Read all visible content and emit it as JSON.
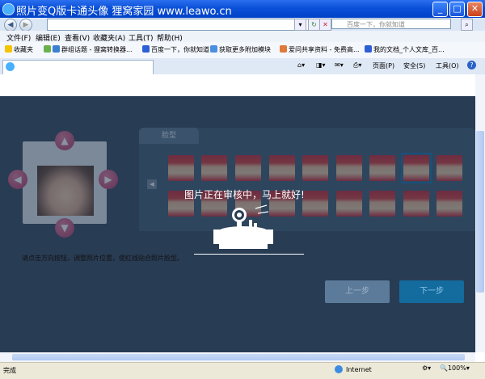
{
  "window": {
    "title": "照片变Q版卡通头像    狸窝家园  www.leawo.cn",
    "minimize": "_",
    "maximize": "□",
    "close": "✕"
  },
  "address_bar": {
    "back": "◀",
    "forward": "▶",
    "url": "",
    "search_placeholder": "百度一下，你就知道"
  },
  "menu": [
    "文件(F)",
    "编辑(E)",
    "查看(V)",
    "收藏夹(A)",
    "工具(T)",
    "帮助(H)"
  ],
  "favorites": {
    "label": "收藏夹",
    "items": [
      "群组话题 - 狸窝转换器...",
      "百度一下，你就知道",
      "获取更多附加模块",
      "爱问共享资料 - 免费高...",
      "我的文档_个人文库_百..."
    ]
  },
  "tab": {
    "label": ""
  },
  "toolbar": {
    "page": "页面(P)",
    "safety": "安全(S)",
    "tools": "工具(O)",
    "help": "?"
  },
  "editor": {
    "face_tab": "脸型",
    "loading_text": "图片正在审核中，马上就好!",
    "instruction": "请点击方向按钮，调整照片位置，使红线贴合照片脸型。",
    "prev_button": "上一步",
    "next_button": "下一步"
  },
  "status": {
    "left": "完成",
    "zone": "Internet",
    "zoom": "100%"
  },
  "colors": {
    "overlay": "#283c54",
    "next_button": "#136b9e",
    "arrow_button": "#b02a5a"
  }
}
